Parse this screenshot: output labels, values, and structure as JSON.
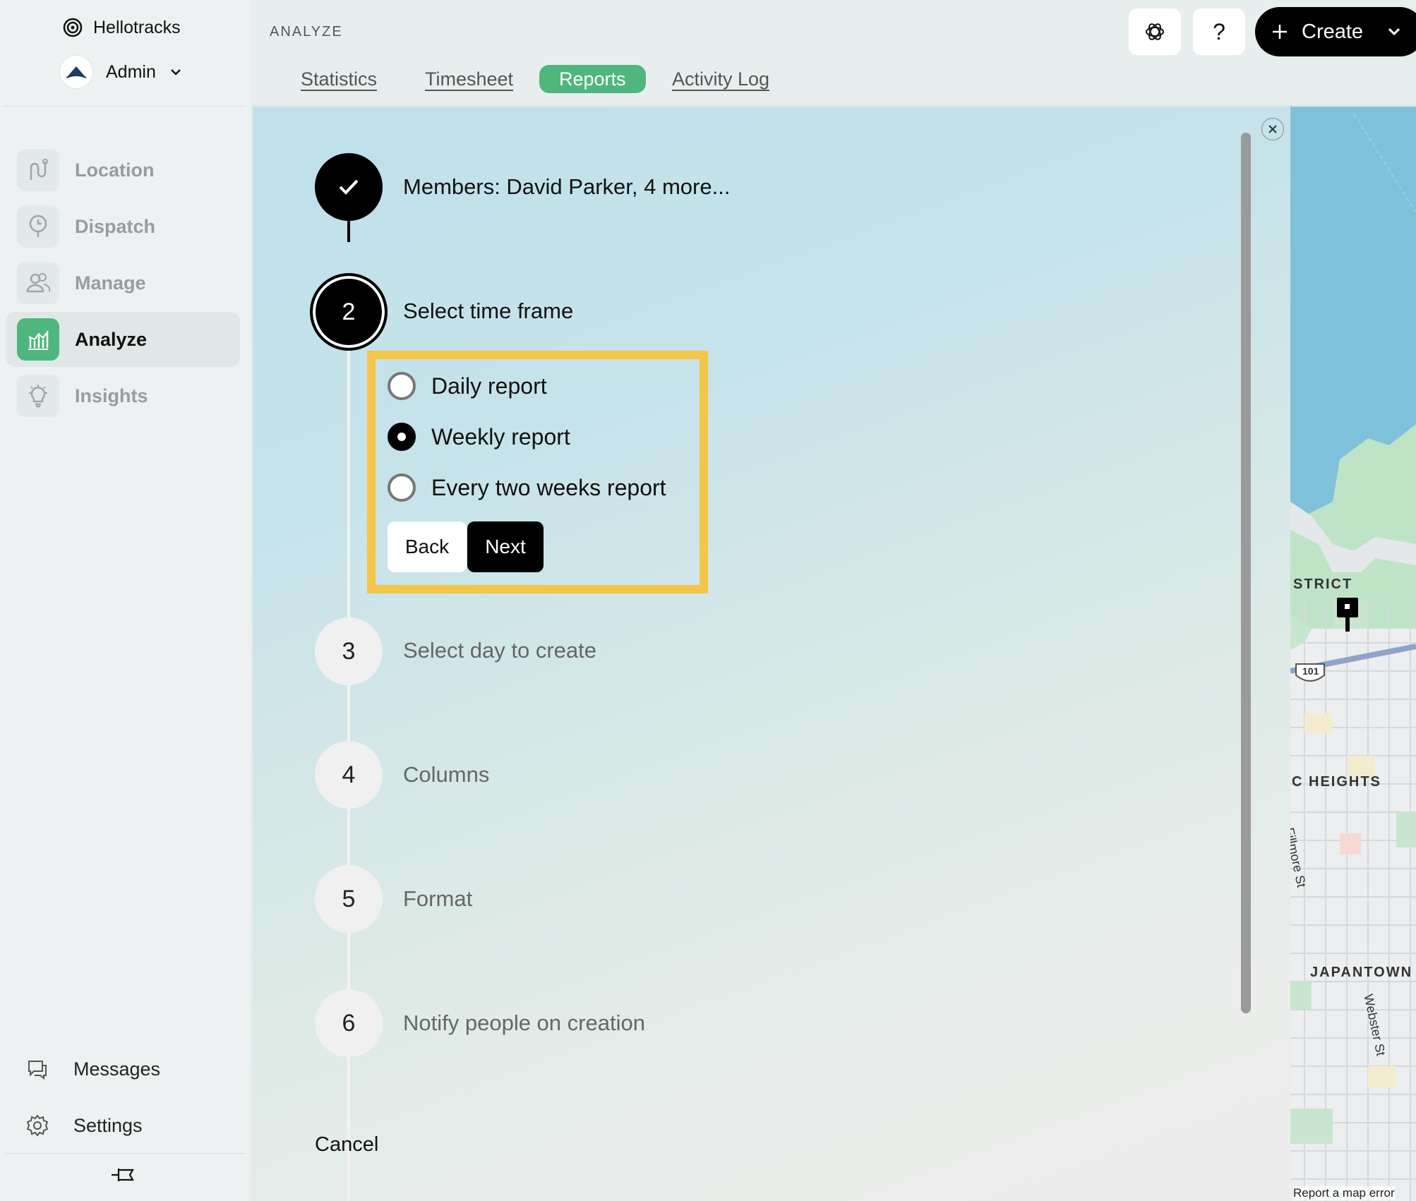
{
  "sidebar": {
    "brand": "Hellotracks",
    "account": "Admin",
    "nav": [
      {
        "label": "Location",
        "icon": "route-icon"
      },
      {
        "label": "Dispatch",
        "icon": "dispatch-icon"
      },
      {
        "label": "Manage",
        "icon": "users-icon"
      },
      {
        "label": "Analyze",
        "icon": "chart-icon",
        "active": true
      },
      {
        "label": "Insights",
        "icon": "lightbulb-icon"
      }
    ],
    "bottom": [
      {
        "label": "Messages",
        "icon": "chat-icon"
      },
      {
        "label": "Settings",
        "icon": "gear-icon"
      }
    ]
  },
  "header": {
    "section": "ANALYZE",
    "tabs": [
      {
        "label": "Statistics"
      },
      {
        "label": "Timesheet"
      },
      {
        "label": "Reports",
        "active": true
      },
      {
        "label": "Activity Log"
      }
    ],
    "help_label": "?",
    "create_label": "Create"
  },
  "wizard": {
    "steps": [
      {
        "number": "",
        "title": "Members: David Parker, 4 more...",
        "state": "done"
      },
      {
        "number": "2",
        "title": "Select time frame",
        "state": "current"
      },
      {
        "number": "3",
        "title": "Select day to create",
        "state": "pending"
      },
      {
        "number": "4",
        "title": "Columns",
        "state": "pending"
      },
      {
        "number": "5",
        "title": "Format",
        "state": "pending"
      },
      {
        "number": "6",
        "title": "Notify people on creation",
        "state": "pending"
      }
    ],
    "options": [
      {
        "label": "Daily report",
        "selected": false
      },
      {
        "label": "Weekly report",
        "selected": true
      },
      {
        "label": "Every two weeks report",
        "selected": false
      }
    ],
    "back_label": "Back",
    "next_label": "Next",
    "cancel_label": "Cancel"
  },
  "map": {
    "labels": [
      "STRICT",
      "C HEIGHTS",
      "Fillmore St",
      "JAPANTOWN",
      "Webster St",
      "101"
    ],
    "footer": "Report a map error"
  },
  "colors": {
    "accent": "#4fb67d",
    "highlight": "#f5c547"
  }
}
